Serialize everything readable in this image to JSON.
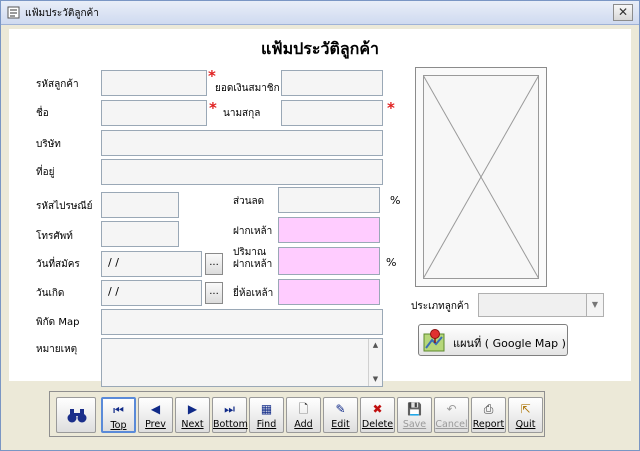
{
  "window": {
    "title": "แฟ้มประวัติลูกค้า",
    "close_glyph": "✕"
  },
  "form": {
    "heading": "แฟ้มประวัติลูกค้า",
    "labels": {
      "customer_code": "รหัสลูกค้า",
      "member_balance": "ยอดเงินสมาชิก",
      "first_name": "ชื่อ",
      "last_name": "นามสกุล",
      "company": "บริษัท",
      "address": "ที่อยู่",
      "postal_code": "รหัสไปรษณีย์",
      "discount": "ส่วนลด",
      "phone": "โทรศัพท์",
      "deposit": "ฝากเหล้า",
      "join_date": "วันที่สมัคร",
      "deposit_amount_line1": "ปริมาณ",
      "deposit_amount_line2": "ฝากเหล้า",
      "birth_date": "วันเกิด",
      "liquor_brand": "ยี่ห้อเหล้า",
      "map_coords": "พิกัด Map",
      "remarks": "หมายเหตุ",
      "customer_type": "ประเภทลูกค้า"
    },
    "values": {
      "customer_code": "",
      "member_balance": "",
      "first_name": "",
      "last_name": "",
      "company": "",
      "address": "",
      "postal_code": "",
      "discount": "",
      "phone": "",
      "deposit": "",
      "join_date": " / /",
      "deposit_amount": "",
      "birth_date": " / /",
      "liquor_brand": "",
      "map_coords": "",
      "remarks": "",
      "customer_type": ""
    },
    "required_mark": "*",
    "percent": "%",
    "date_picker": "...",
    "map_button": "แผนที่ ( Google Map )"
  },
  "toolbar": {
    "buttons": [
      {
        "label": "",
        "icon": "binoculars-icon"
      },
      {
        "label": "Top",
        "icon": "first-icon"
      },
      {
        "label": "Prev",
        "icon": "prev-icon"
      },
      {
        "label": "Next",
        "icon": "next-icon"
      },
      {
        "label": "Bottom",
        "icon": "last-icon"
      },
      {
        "label": "Find",
        "icon": "find-icon"
      },
      {
        "label": "Add",
        "icon": "add-icon"
      },
      {
        "label": "Edit",
        "icon": "edit-icon"
      },
      {
        "label": "Delete",
        "icon": "delete-icon"
      },
      {
        "label": "Save",
        "icon": "save-icon"
      },
      {
        "label": "Cancel",
        "icon": "cancel-icon"
      },
      {
        "label": "Report",
        "icon": "print-icon"
      },
      {
        "label": "Quit",
        "icon": "quit-icon"
      }
    ],
    "glyphs": {
      "binoculars": "👓",
      "first": "⏮",
      "prev": "◀",
      "next": "▶",
      "last": "⏭",
      "find": "▦",
      "add": "🗋",
      "edit": "✎",
      "delete": "✖",
      "save": "💾",
      "cancel": "↶",
      "report": "⎙",
      "quit": "⇱"
    }
  },
  "colors": {
    "highlight_field": "#ffccff",
    "required": "#e02020",
    "active_border": "#5a8ad8"
  }
}
